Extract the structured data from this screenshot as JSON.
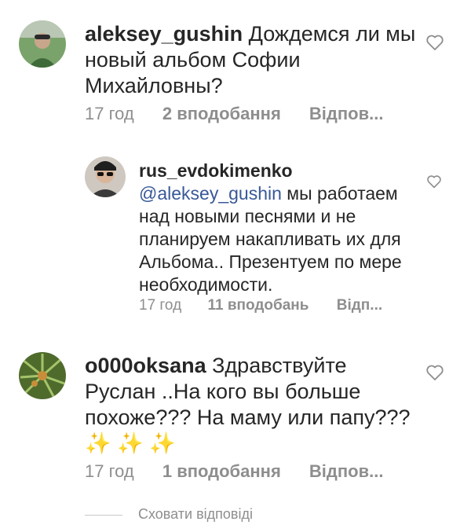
{
  "comments": [
    {
      "username": "aleksey_gushin",
      "text": "Дождемся ли мы новый альбом Софии Михайловны?",
      "time": "17 год",
      "likes": "2 вподобання",
      "reply": "Відпов..."
    },
    {
      "username": "rus_evdokimenko",
      "mention": "@aleksey_gushin",
      "text": "мы работаем над новыми песнями и не планируем накапливать их для Альбома.. Презентуем по мере необходимости.",
      "time": "17 год",
      "likes": "11 вподобань",
      "reply": "Відп..."
    },
    {
      "username": "o000oksana",
      "text": "Здравствуйте Руслан ..На кого вы больше похоже??? На маму или папу???",
      "emoji": "✨ ✨ ✨",
      "time": "17 год",
      "likes": "1 вподобання",
      "reply": "Відпов..."
    }
  ],
  "hide_replies": "Сховати відповіді",
  "colors": {
    "text": "#262626",
    "secondary": "#8e8e8e",
    "mention": "#385898",
    "sparkle": "#f3c623"
  },
  "icons": {
    "like": "heart-outline-icon"
  }
}
